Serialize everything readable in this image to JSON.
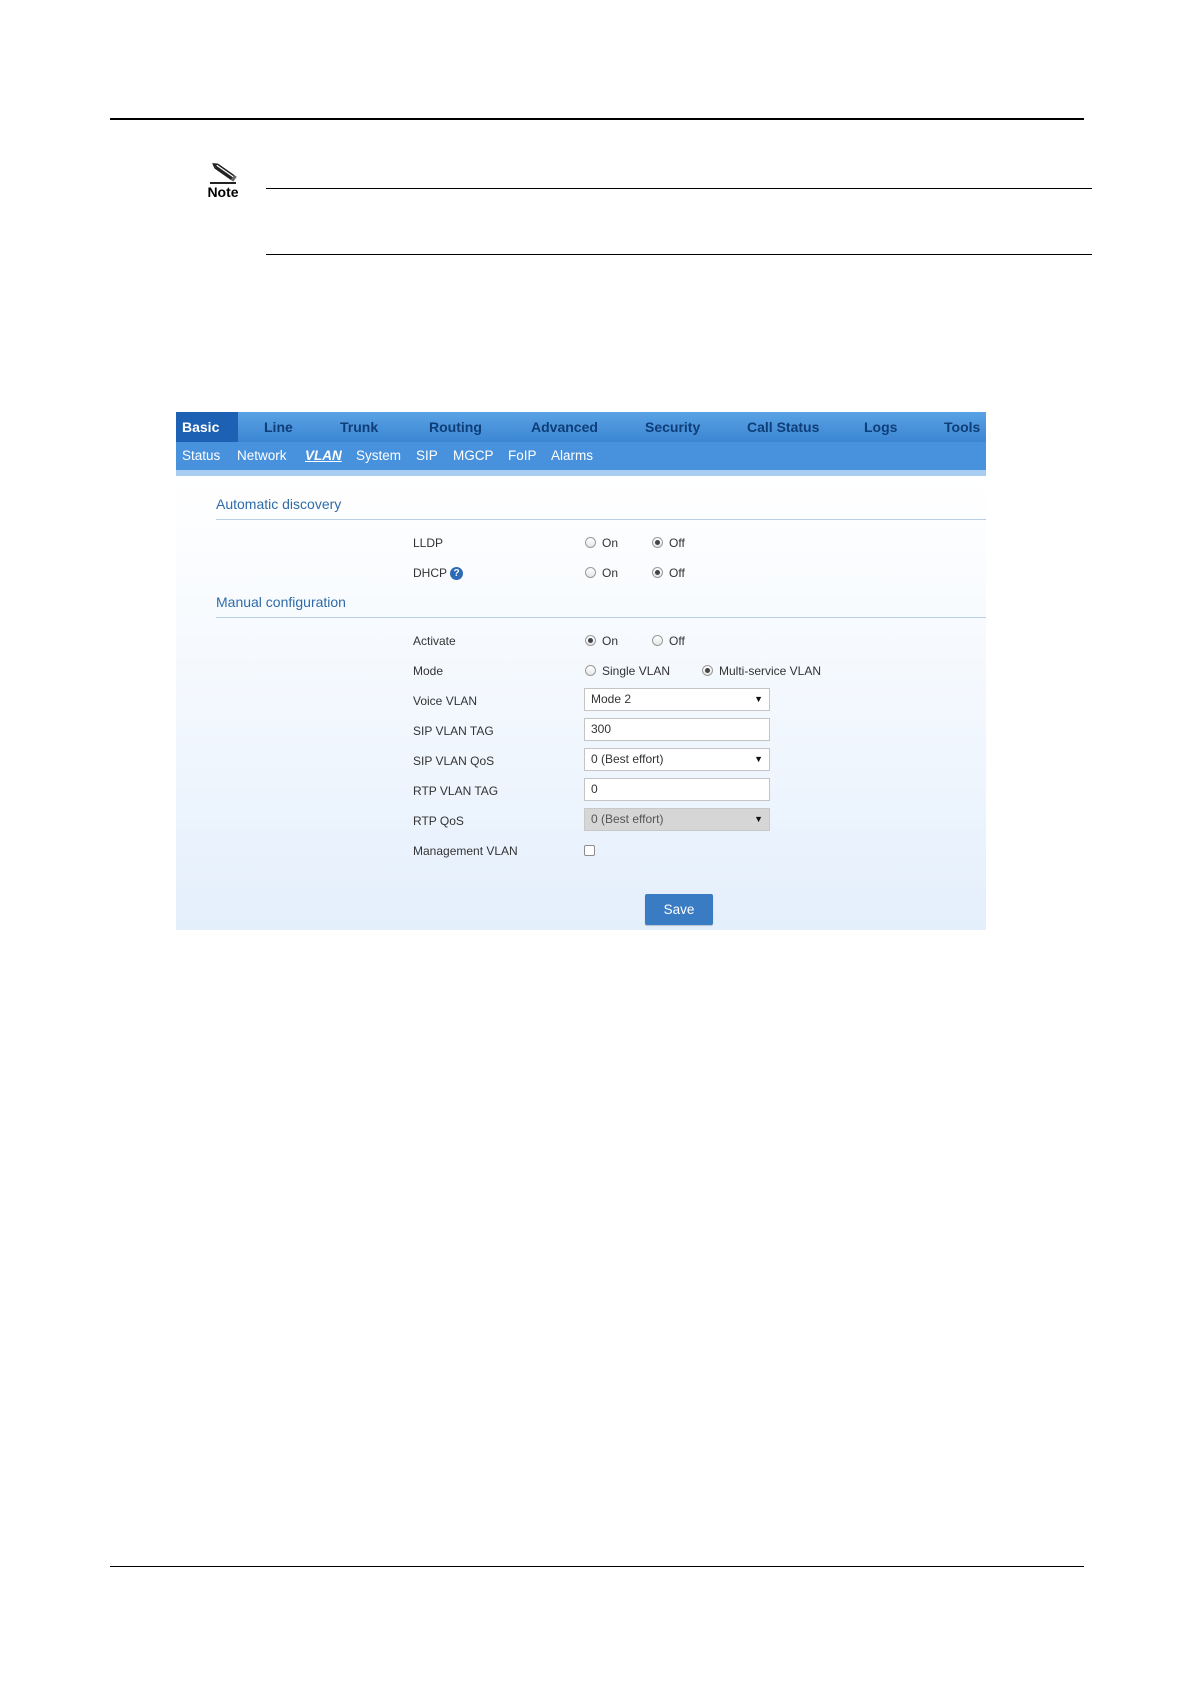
{
  "document": {
    "note_label": "Note"
  },
  "nav": {
    "tabs": [
      "Basic",
      "Line",
      "Trunk",
      "Routing",
      "Advanced",
      "Security",
      "Call Status",
      "Logs",
      "Tools"
    ],
    "active_tab": "Basic",
    "subtabs": [
      "Status",
      "Network",
      "VLAN",
      "System",
      "SIP",
      "MGCP",
      "FoIP",
      "Alarms"
    ],
    "active_subtab": "VLAN"
  },
  "automatic_discovery": {
    "title": "Automatic discovery",
    "lldp": {
      "label": "LLDP",
      "on_label": "On",
      "off_label": "Off",
      "selected": "Off"
    },
    "dhcp": {
      "label": "DHCP",
      "on_label": "On",
      "off_label": "Off",
      "selected": "Off"
    }
  },
  "manual_configuration": {
    "title": "Manual configuration",
    "activate": {
      "label": "Activate",
      "on_label": "On",
      "off_label": "Off",
      "selected": "On"
    },
    "mode": {
      "label": "Mode",
      "option_single": "Single VLAN",
      "option_multi": "Multi-service VLAN",
      "selected": "Multi-service VLAN"
    },
    "voice_vlan": {
      "label": "Voice VLAN",
      "value": "Mode 2"
    },
    "sip_vlan_tag": {
      "label": "SIP VLAN TAG",
      "value": "300"
    },
    "sip_vlan_qos": {
      "label": "SIP VLAN QoS",
      "value": "0 (Best effort)"
    },
    "rtp_vlan_tag": {
      "label": "RTP VLAN TAG",
      "value": "0"
    },
    "rtp_qos": {
      "label": "RTP QoS",
      "value": "0 (Best effort)",
      "disabled": true
    },
    "management_vlan": {
      "label": "Management VLAN",
      "checked": false
    }
  },
  "actions": {
    "save_label": "Save"
  },
  "colors": {
    "nav_bar": "#4891dc",
    "active_tab": "#1d61b4",
    "section_title": "#2f6ba8",
    "save_button": "#3a7cc4"
  }
}
